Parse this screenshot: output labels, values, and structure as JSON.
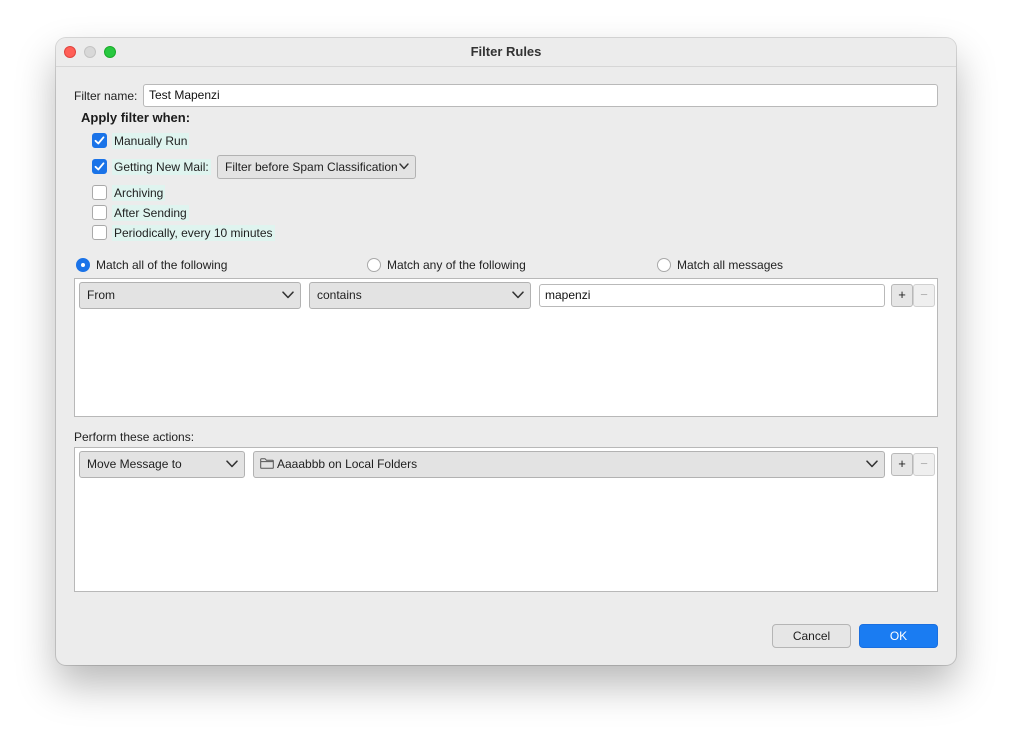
{
  "window": {
    "title": "Filter Rules"
  },
  "filter_name": {
    "label": "Filter name:",
    "value": "Test Mapenzi"
  },
  "apply_when": {
    "heading": "Apply filter when:",
    "options": [
      {
        "label": "Manually Run",
        "checked": true
      },
      {
        "label": "Getting New Mail:",
        "checked": true
      },
      {
        "label": "Archiving",
        "checked": false
      },
      {
        "label": "After Sending",
        "checked": false
      },
      {
        "label": "Periodically, every 10 minutes",
        "checked": false
      }
    ],
    "new_mail_timing": {
      "selected": "Filter before Spam Classification"
    }
  },
  "match_mode": {
    "options": [
      {
        "label": "Match all of the following",
        "selected": true
      },
      {
        "label": "Match any of the following",
        "selected": false
      },
      {
        "label": "Match all messages",
        "selected": false
      }
    ]
  },
  "criteria": [
    {
      "field": "From",
      "operator": "contains",
      "value": "mapenzi"
    }
  ],
  "actions": {
    "label": "Perform these actions:",
    "items": [
      {
        "action": "Move Message to",
        "target": "Aaaabbb on Local Folders"
      }
    ]
  },
  "buttons": {
    "add": "+",
    "remove": "−",
    "cancel": "Cancel",
    "ok": "OK"
  },
  "colors": {
    "accent": "#1a73e8",
    "ok_button": "#1a7cf2",
    "highlight": "#dff4ef"
  },
  "icons": [
    "check-icon",
    "chevron-down-icon",
    "folder-icon"
  ]
}
